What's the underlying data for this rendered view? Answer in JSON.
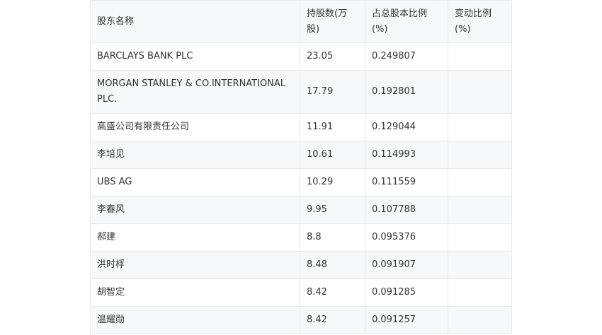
{
  "table": {
    "headers": [
      "股东名称",
      "持股数(万股)",
      "占总股本比例(%)",
      "变动比例(%)"
    ],
    "rows": [
      [
        "BARCLAYS BANK PLC",
        "23.05",
        "0.249807",
        ""
      ],
      [
        "MORGAN STANLEY & CO.INTERNATIONAL PLC.",
        "17.79",
        "0.192801",
        ""
      ],
      [
        "高盛公司有限责任公司",
        "11.91",
        "0.129044",
        ""
      ],
      [
        "李培见",
        "10.61",
        "0.114993",
        ""
      ],
      [
        "UBS AG",
        "10.29",
        "0.111559",
        ""
      ],
      [
        "李春风",
        "9.95",
        "0.107788",
        ""
      ],
      [
        "郝建",
        "8.8",
        "0.095376",
        ""
      ],
      [
        "洪时桴",
        "8.48",
        "0.091907",
        ""
      ],
      [
        "胡智定",
        "8.42",
        "0.091285",
        ""
      ],
      [
        "温耀勋",
        "8.42",
        "0.091257",
        ""
      ]
    ]
  }
}
